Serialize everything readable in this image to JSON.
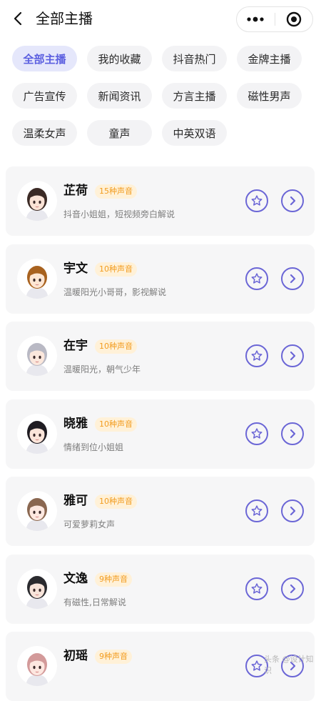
{
  "header": {
    "title": "全部主播"
  },
  "filters": [
    {
      "label": "全部主播",
      "active": true
    },
    {
      "label": "我的收藏",
      "active": false
    },
    {
      "label": "抖音热门",
      "active": false
    },
    {
      "label": "金牌主播",
      "active": false
    },
    {
      "label": "广告宣传",
      "active": false
    },
    {
      "label": "新闻资讯",
      "active": false
    },
    {
      "label": "方言主播",
      "active": false
    },
    {
      "label": "磁性男声",
      "active": false
    },
    {
      "label": "温柔女声",
      "active": false
    },
    {
      "label": "童声",
      "active": false
    },
    {
      "label": "中英双语",
      "active": false
    }
  ],
  "anchors": [
    {
      "name": "芷荷",
      "voices": "15种声音",
      "desc": "抖音小姐姐，短视频旁白解说",
      "hair": "#3b2a25",
      "skin": "#fbe3d6"
    },
    {
      "name": "宇文",
      "voices": "10种声音",
      "desc": "温暖阳光小哥哥，影视解说",
      "hair": "#a8621f",
      "skin": "#fde6d3"
    },
    {
      "name": "在宇",
      "voices": "10种声音",
      "desc": "温暖阳光，朝气少年",
      "hair": "#b9b9c4",
      "skin": "#fbe7dc"
    },
    {
      "name": "晓雅",
      "voices": "10种声音",
      "desc": "情绪到位小姐姐",
      "hair": "#1f1c22",
      "skin": "#fbe5da"
    },
    {
      "name": "雅可",
      "voices": "10种声音",
      "desc": "可爱萝莉女声",
      "hair": "#8a6750",
      "skin": "#fde8e0"
    },
    {
      "name": "文逸",
      "voices": "9种声音",
      "desc": "有磁性,日常解说",
      "hair": "#2a2a2e",
      "skin": "#f7e4da"
    },
    {
      "name": "初瑶",
      "voices": "9种声音",
      "desc": "",
      "hair": "#d39a9a",
      "skin": "#fde7e0"
    }
  ],
  "colors": {
    "accent": "#6b66d6",
    "badge_text": "#f29c1f",
    "badge_bg": "#fff1d8"
  },
  "icons": {
    "favorite": "star-outline-icon",
    "open": "chevron-right-icon"
  },
  "watermark": "头条 @设计知识"
}
